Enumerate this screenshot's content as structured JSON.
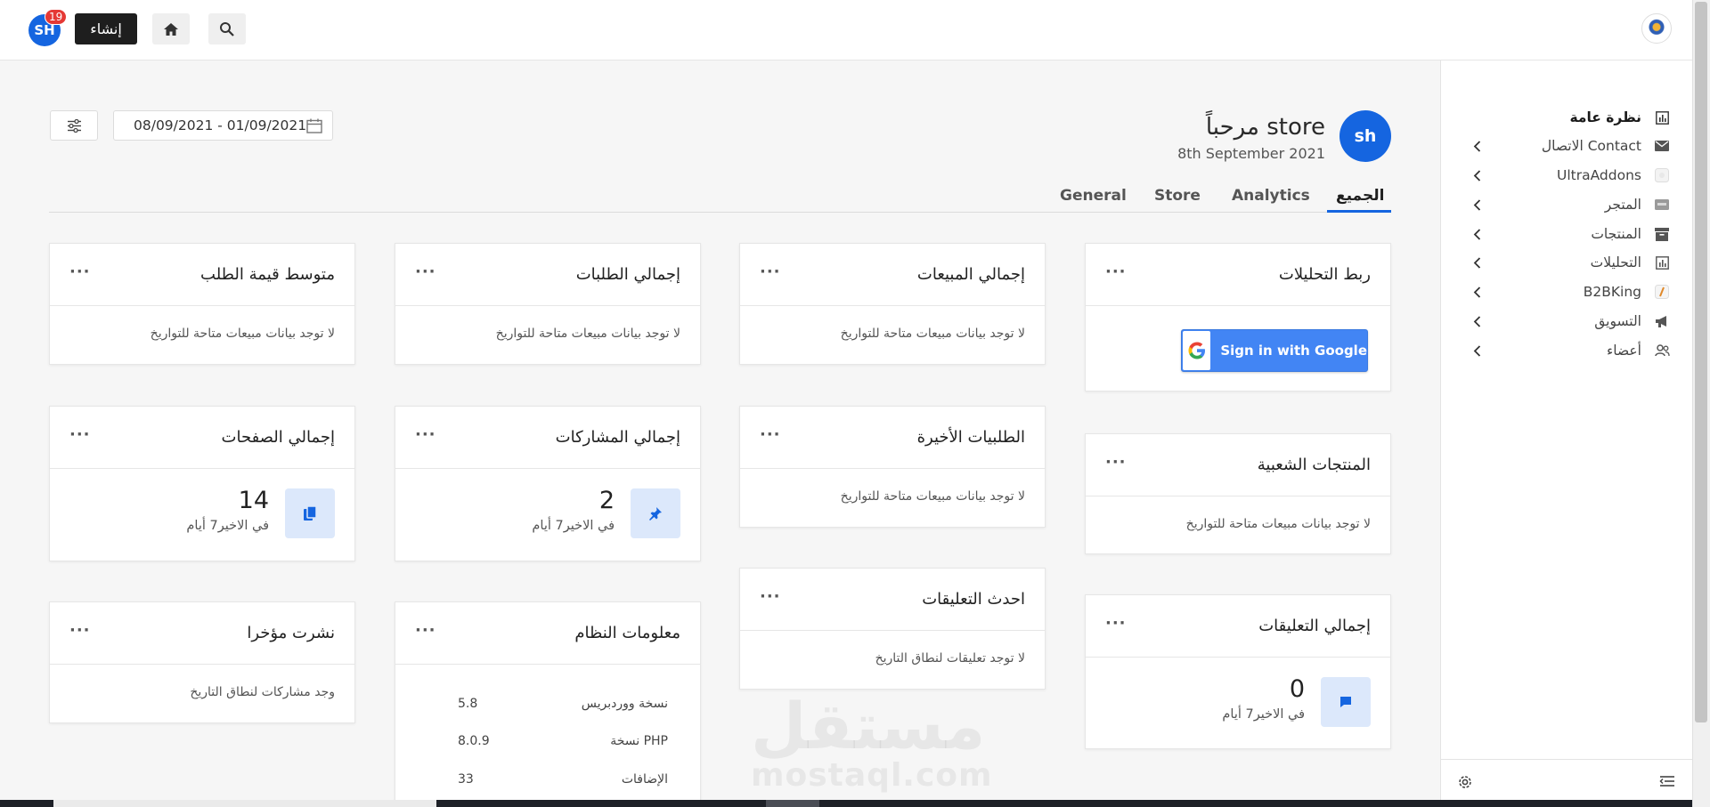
{
  "topbar": {
    "avatar_initials": "SH",
    "notification_count": "19",
    "create_label": "إنشاء"
  },
  "sidebar": {
    "items": [
      {
        "label": "نظرة عامة",
        "icon": "chart-icon"
      },
      {
        "label": "Contact الاتصال",
        "icon": "mail-icon"
      },
      {
        "label": "UltraAddons",
        "icon": "addons-icon"
      },
      {
        "label": "المتجر",
        "icon": "store-icon"
      },
      {
        "label": "المنتجات",
        "icon": "archive-icon"
      },
      {
        "label": "التحليلات",
        "icon": "analytics-icon"
      },
      {
        "label": "B2BKing",
        "icon": "b2bking-icon"
      },
      {
        "label": "التسويق",
        "icon": "megaphone-icon"
      },
      {
        "label": "أعضاء",
        "icon": "users-icon"
      }
    ]
  },
  "header": {
    "avatar": "sh",
    "welcome": "مرحباً store",
    "date": "8th September 2021",
    "date_range": "08/09/2021 - 01/09/2021"
  },
  "tabs": [
    "الجميع",
    "Analytics",
    "Store",
    "General"
  ],
  "cards": {
    "link_analytics": {
      "title": "ربط التحليلات",
      "google": "Sign in with Google"
    },
    "total_sales": {
      "title": "إجمالي المبيعات",
      "text": "لا توجد بيانات مبيعات متاحة للتواريخ"
    },
    "total_orders": {
      "title": "إجمالي الطلبات",
      "text": "لا توجد بيانات مبيعات متاحة للتواريخ"
    },
    "avg_order": {
      "title": "متوسط قيمة الطلب",
      "text": "لا توجد بيانات مبيعات متاحة للتواريخ"
    },
    "popular_products": {
      "title": "المنتجات الشعبية",
      "text": "لا توجد بيانات مبيعات متاحة للتواريخ"
    },
    "recent_orders": {
      "title": "الطلبيات الأخيرة",
      "text": "لا توجد بيانات مبيعات متاحة للتواريخ"
    },
    "total_posts": {
      "title": "إجمالي المشاركات",
      "value": "2",
      "sub": "في الاخير7 أيام"
    },
    "total_pages": {
      "title": "إجمالي الصفحات",
      "value": "14",
      "sub": "في الاخير7 أيام"
    },
    "total_comments": {
      "title": "إجمالي التعليقات",
      "value": "0",
      "sub": "في الاخير7 أيام"
    },
    "latest_comments": {
      "title": "احدث التعليقات",
      "text": "لا توجد تعليقات لنطاق التاريخ"
    },
    "system_info": {
      "title": "معلومات النظام",
      "rows": [
        {
          "key": "نسخة ووردبريس",
          "value": "5.8"
        },
        {
          "key": "PHP نسخة",
          "value": "8.0.9"
        },
        {
          "key": "الإضافات",
          "value": "33"
        }
      ]
    },
    "recently_published": {
      "title": "نشرت مؤخرا",
      "text": "وجد مشاركات لنطاق التاريخ"
    }
  },
  "dots": "···",
  "watermark": {
    "arabic": "مستقل",
    "latin": "mostaql.com"
  },
  "colors": {
    "accent": "#1565e0",
    "badge": "#e53935",
    "google": "#4285f4"
  }
}
